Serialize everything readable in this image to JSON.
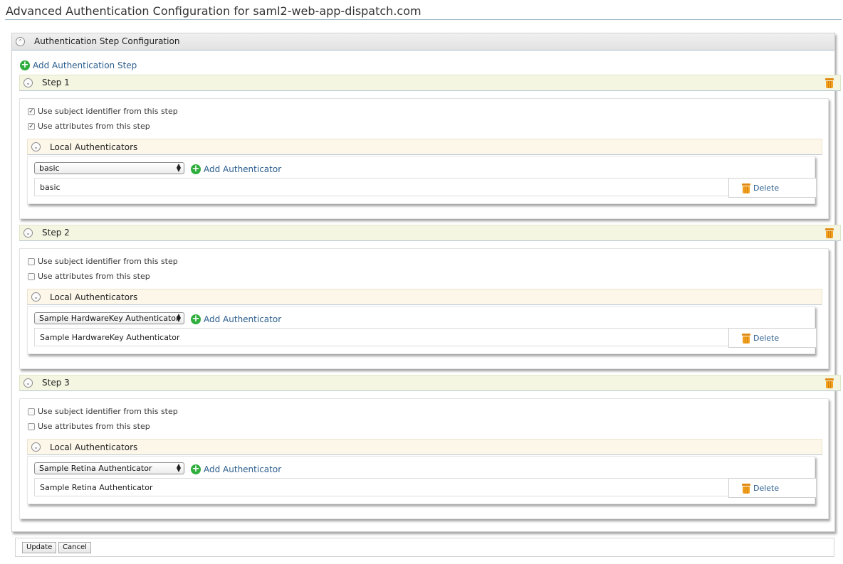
{
  "page": {
    "title": "Advanced Authentication Configuration for saml2-web-app-dispatch.com"
  },
  "section": {
    "title": "Authentication Step Configuration",
    "add_step_label": "Add Authentication Step"
  },
  "steps": [
    {
      "title": "Step 1",
      "use_subject_label": "Use subject identifier from this step",
      "use_subject_checked": true,
      "use_attributes_label": "Use attributes from this step",
      "use_attributes_checked": true,
      "local_title": "Local Authenticators",
      "selected_authenticator": "basic",
      "add_authenticator_label": "Add Authenticator",
      "authenticators": [
        "basic"
      ],
      "delete_label": "Delete"
    },
    {
      "title": "Step 2",
      "use_subject_label": "Use subject identifier from this step",
      "use_subject_checked": false,
      "use_attributes_label": "Use attributes from this step",
      "use_attributes_checked": false,
      "local_title": "Local Authenticators",
      "selected_authenticator": "Sample HardwareKey Authenticator",
      "add_authenticator_label": "Add Authenticator",
      "authenticators": [
        "Sample HardwareKey Authenticator"
      ],
      "delete_label": "Delete"
    },
    {
      "title": "Step 3",
      "use_subject_label": "Use subject identifier from this step",
      "use_subject_checked": false,
      "use_attributes_label": "Use attributes from this step",
      "use_attributes_checked": false,
      "local_title": "Local Authenticators",
      "selected_authenticator": "Sample Retina Authenticator",
      "add_authenticator_label": "Add Authenticator",
      "authenticators": [
        "Sample Retina Authenticator"
      ],
      "delete_label": "Delete"
    }
  ],
  "footer": {
    "update_label": "Update",
    "cancel_label": "Cancel"
  }
}
